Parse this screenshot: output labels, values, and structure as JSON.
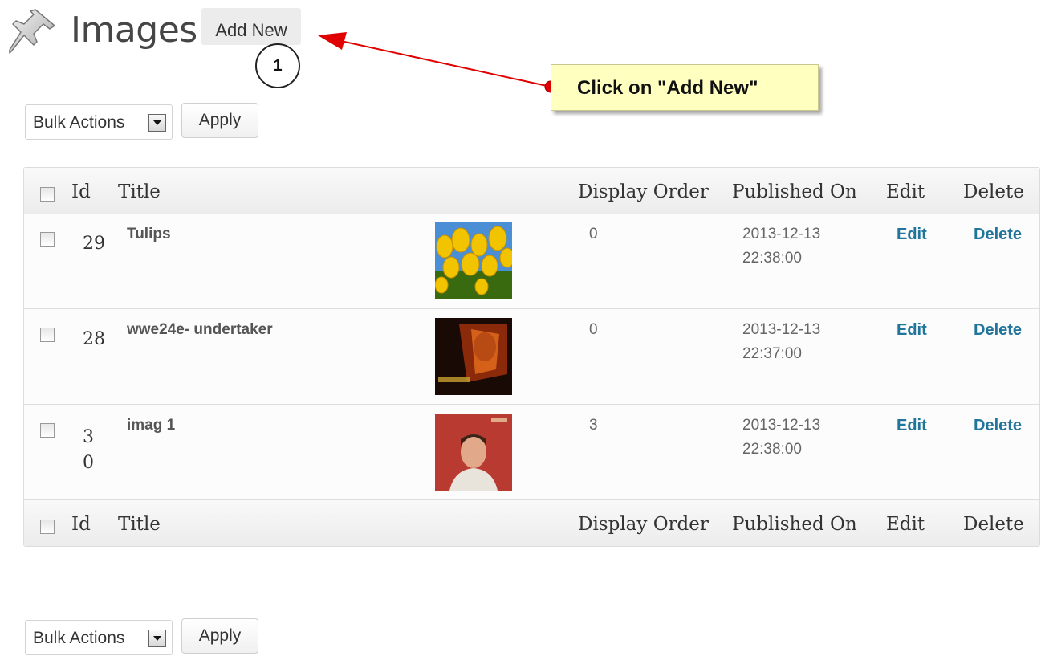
{
  "header": {
    "title": "Images",
    "add_new_label": "Add New",
    "step_number": "1",
    "callout_text": "Click on \"Add New\""
  },
  "bulk_top": {
    "select_value": "Bulk Actions",
    "apply_label": "Apply"
  },
  "bulk_bottom": {
    "select_value": "Bulk Actions",
    "apply_label": "Apply"
  },
  "table": {
    "columns": {
      "id": "Id",
      "title": "Title",
      "display_order": "Display Order",
      "published_on": "Published On",
      "edit": "Edit",
      "delete": "Delete"
    },
    "rows": [
      {
        "id": "29",
        "title": "Tulips",
        "display_order": "0",
        "published_on": "2013-12-13 22:38:00",
        "edit": "Edit",
        "delete": "Delete",
        "thumb": "tulips-thumbnail"
      },
      {
        "id": "28",
        "title": "wwe24e- undertaker",
        "display_order": "0",
        "published_on": "2013-12-13 22:37:00",
        "edit": "Edit",
        "delete": "Delete",
        "thumb": "undertaker-thumbnail"
      },
      {
        "id": "30",
        "title": "imag 1",
        "display_order": "3",
        "published_on": "2013-12-13 22:38:00",
        "edit": "Edit",
        "delete": "Delete",
        "thumb": "portrait-thumbnail"
      }
    ]
  },
  "colors": {
    "link": "#21759b",
    "callout_bg": "#ffffc0",
    "arrow": "#e00000"
  },
  "icons": {
    "page_icon": "pushpin-icon"
  }
}
